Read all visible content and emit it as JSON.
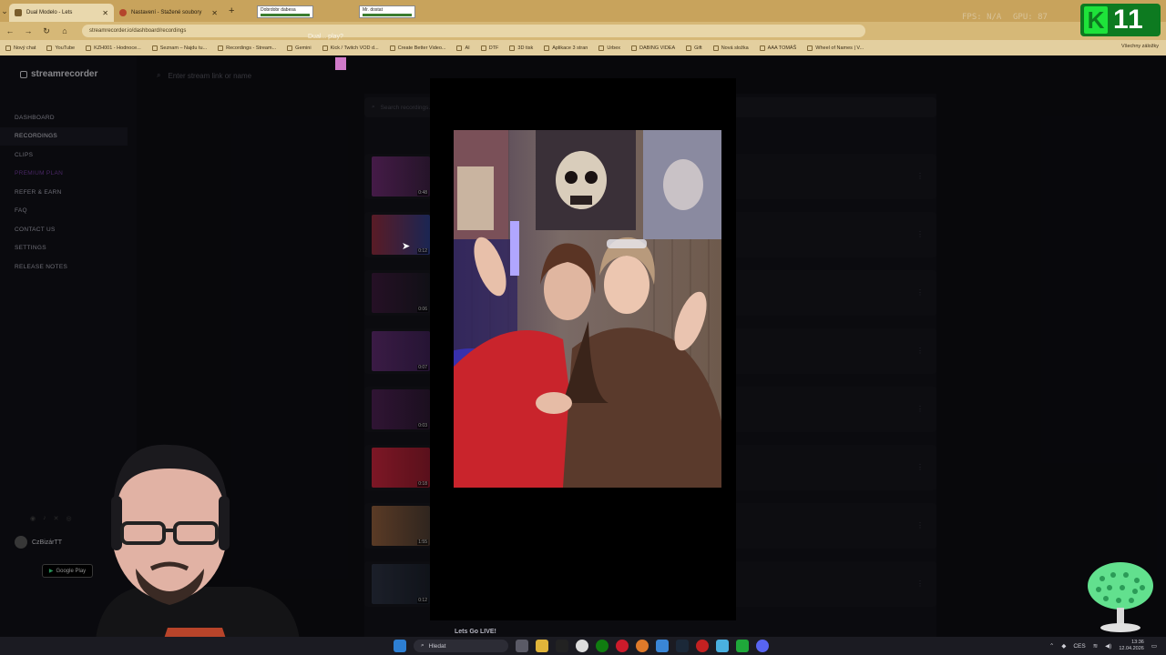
{
  "browser": {
    "tabs": [
      {
        "title": "Dual Modelo - Lets"
      },
      {
        "title": "Nastavení - Stažené soubory"
      }
    ],
    "new_tab_label": "+",
    "mini_windows": [
      {
        "title": "Dobrdobr dabesa"
      },
      {
        "title": "Mr. dostat"
      }
    ],
    "overlay_stats": {
      "fps": "FPS: N/A",
      "gpu": "GPU: 87"
    },
    "url": "streamrecorder.io/dashboard/recordings",
    "floating_label": "Dual... play?",
    "bookmarks": [
      "Nový chat",
      "YouTube",
      "KZH001 - Hodnoce...",
      "Seznam – Najdu tu...",
      "Recordings - Stream...",
      "Gemini",
      "Kick / Twitch VOD d...",
      "Create Better Video...",
      "AI",
      "DTF",
      "3D tisk",
      "Aplikace 3 stran",
      "Urbex",
      "DABING VIDEA",
      "Gift",
      "Nová složka",
      "AAA TOMÁŠ",
      "Wheel of Names | V..."
    ],
    "bookmarks_right": "Všechny záložky"
  },
  "site": {
    "logo": "streamrecorder",
    "search_placeholder": "Enter stream link or name",
    "nav": [
      {
        "label": "DASHBOARD",
        "active": false
      },
      {
        "label": "RECORDINGS",
        "active": true
      },
      {
        "label": "CLIPS",
        "active": false
      },
      {
        "label": "PREMIUM PLAN",
        "active": false
      },
      {
        "label": "REFER & EARN",
        "active": false
      },
      {
        "label": "FAQ",
        "active": false
      },
      {
        "label": "CONTACT US",
        "active": false
      },
      {
        "label": "SETTINGS",
        "active": false
      },
      {
        "label": "RELEASE NOTES",
        "active": false
      }
    ],
    "recordings_search_placeholder": "Search recordings...",
    "recordings": [
      {
        "duration": "0:48"
      },
      {
        "duration": "0:12"
      },
      {
        "duration": "0:06"
      },
      {
        "duration": "0:07"
      },
      {
        "duration": "0:03"
      },
      {
        "duration": "0:18"
      },
      {
        "duration": "1:55"
      },
      {
        "duration": "0:12"
      }
    ],
    "playing_title": "Lets Go LIVE!",
    "user": {
      "name": "CzBizárTT"
    },
    "google_play": "Google Play"
  },
  "overlay": {
    "badge_letter": "K",
    "badge_number": "11"
  },
  "taskbar": {
    "search_label": "Hledat",
    "lang": "CES",
    "time": "13:36",
    "date": "12.04.2026"
  }
}
